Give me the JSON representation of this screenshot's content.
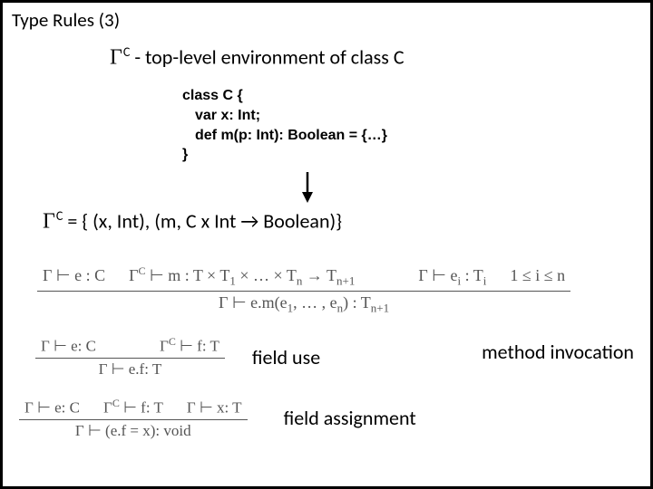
{
  "title": "Type Rules (3)",
  "gamma_def_prefix": "Γ",
  "gamma_def_sup": "C",
  "gamma_def_text": "  - top-level environment of class C",
  "code": {
    "l1": "class C {",
    "l2": "var x: Int;",
    "l3": "def m(p: Int): Boolean = {…}",
    "l4": "}"
  },
  "gamma_eq_prefix": "Γ",
  "gamma_eq_sup": "C",
  "gamma_eq_text": " = { (x, Int), (m, C x Int → Boolean)}",
  "rules": {
    "method": {
      "top_a": "Γ ⊢ e : C",
      "top_b": "Γ",
      "top_b_sup": "C",
      "top_b_rest": " ⊢ m : T × T",
      "top_b_sub1": "1",
      "top_b_mid": " × … × T",
      "top_b_subn": "n",
      "top_b_arrow": " → T",
      "top_b_subn1": "n+1",
      "top_c": "Γ ⊢ e",
      "top_c_subi": "i",
      "top_c_rest": " : T",
      "top_c_subi2": "i",
      "top_d": "1 ≤ i ≤ n",
      "bot": "Γ ⊢ e.m(e",
      "bot_sub1": "1",
      "bot_mid": ", … , e",
      "bot_subn": "n",
      "bot_rest": ") : T",
      "bot_subn1": "n+1",
      "label": "method invocation"
    },
    "field": {
      "top_a": "Γ ⊢ e: C",
      "top_b": "Γ",
      "top_b_sup": "C",
      "top_b_rest": " ⊢ f: T",
      "bot": "Γ ⊢ e.f: T",
      "label": "field use"
    },
    "assign": {
      "top_a": "Γ ⊢ e: C",
      "top_b": "Γ",
      "top_b_sup": "C",
      "top_b_rest": " ⊢ f: T",
      "top_c": "Γ ⊢ x: T",
      "bot": "Γ ⊢ (e.f = x): void",
      "label": "field assignment"
    }
  }
}
